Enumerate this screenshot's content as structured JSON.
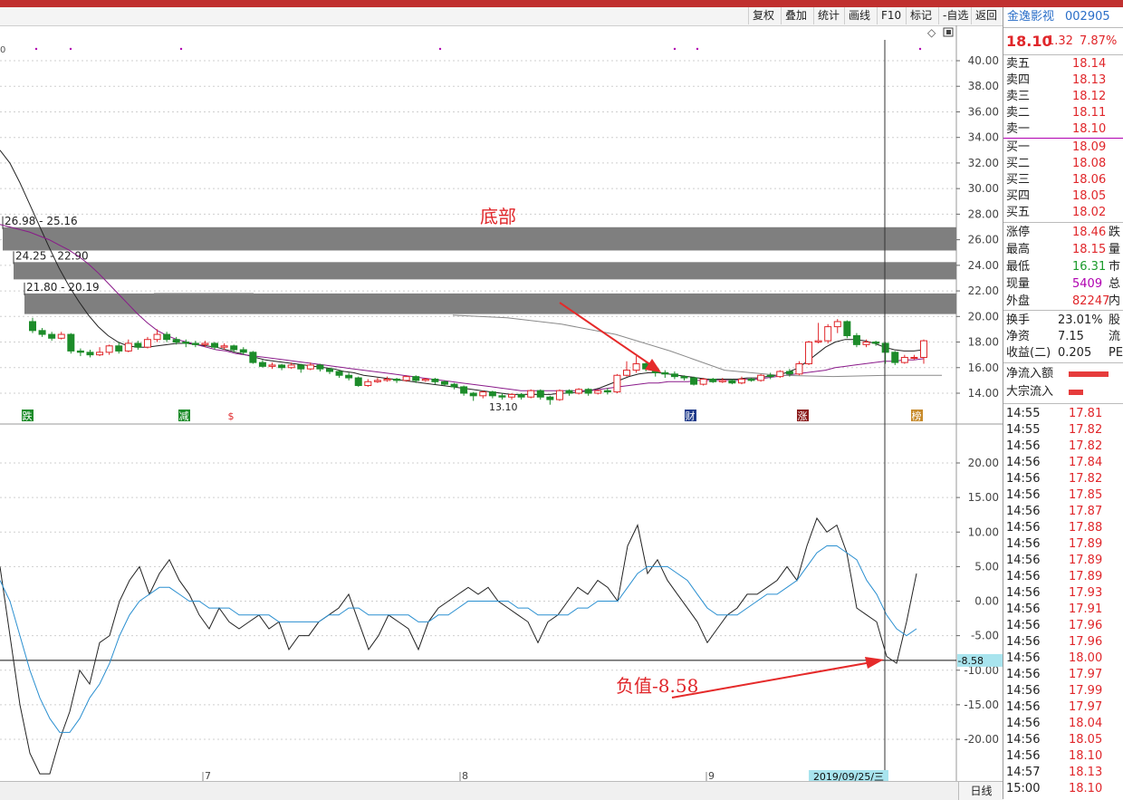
{
  "toolbar": {
    "buttons": [
      "复权",
      "叠加",
      "统计",
      "画线",
      "F10",
      "标记",
      "-自选",
      "返回"
    ]
  },
  "stock": {
    "name": "金逸影视",
    "code": "002905",
    "price": "18.10",
    "change": "1.32",
    "change_pct": "7.87%"
  },
  "order_book": {
    "asks": [
      {
        "label": "卖五",
        "price": "18.14"
      },
      {
        "label": "卖四",
        "price": "18.13"
      },
      {
        "label": "卖三",
        "price": "18.12"
      },
      {
        "label": "卖二",
        "price": "18.11"
      },
      {
        "label": "卖一",
        "price": "18.10"
      }
    ],
    "bids": [
      {
        "label": "买一",
        "price": "18.09"
      },
      {
        "label": "买二",
        "price": "18.08"
      },
      {
        "label": "买三",
        "price": "18.06"
      },
      {
        "label": "买四",
        "price": "18.05"
      },
      {
        "label": "买五",
        "price": "18.02"
      }
    ]
  },
  "stats": [
    {
      "label": "涨停",
      "value": "18.46",
      "tail": "跌"
    },
    {
      "label": "最高",
      "value": "18.15",
      "tail": "量"
    },
    {
      "label": "最低",
      "value": "16.31",
      "tail": "市"
    },
    {
      "label": "现量",
      "value": "5409",
      "tail": "总"
    },
    {
      "label": "外盘",
      "value": "82247",
      "tail": "内"
    }
  ],
  "stats2": [
    {
      "label": "换手",
      "value": "23.01%",
      "tail": "股"
    },
    {
      "label": "净资",
      "value": "7.15",
      "tail": "流"
    },
    {
      "label": "收益(二)",
      "value": "0.205",
      "tail": "PE"
    }
  ],
  "flows": [
    {
      "label": "净流入额"
    },
    {
      "label": "大宗流入"
    }
  ],
  "ticks": [
    {
      "t": "14:55",
      "p": "17.81"
    },
    {
      "t": "14:55",
      "p": "17.82"
    },
    {
      "t": "14:56",
      "p": "17.82"
    },
    {
      "t": "14:56",
      "p": "17.84"
    },
    {
      "t": "14:56",
      "p": "17.82"
    },
    {
      "t": "14:56",
      "p": "17.85"
    },
    {
      "t": "14:56",
      "p": "17.87"
    },
    {
      "t": "14:56",
      "p": "17.88"
    },
    {
      "t": "14:56",
      "p": "17.89"
    },
    {
      "t": "14:56",
      "p": "17.89"
    },
    {
      "t": "14:56",
      "p": "17.89"
    },
    {
      "t": "14:56",
      "p": "17.93"
    },
    {
      "t": "14:56",
      "p": "17.91"
    },
    {
      "t": "14:56",
      "p": "17.96"
    },
    {
      "t": "14:56",
      "p": "17.96"
    },
    {
      "t": "14:56",
      "p": "18.00"
    },
    {
      "t": "14:56",
      "p": "17.97"
    },
    {
      "t": "14:56",
      "p": "17.99"
    },
    {
      "t": "14:56",
      "p": "17.97"
    },
    {
      "t": "14:56",
      "p": "18.04"
    },
    {
      "t": "14:56",
      "p": "18.05"
    },
    {
      "t": "14:56",
      "p": "18.10"
    },
    {
      "t": "14:57",
      "p": "18.13"
    },
    {
      "t": "15:00",
      "p": "18.10"
    }
  ],
  "chart": {
    "price_axis": [
      "40.00",
      "38.00",
      "36.00",
      "34.00",
      "32.00",
      "30.00",
      "28.00",
      "26.00",
      "24.00",
      "22.00",
      "20.00",
      "18.00",
      "16.00",
      "14.00"
    ],
    "price_range": [
      14,
      40
    ],
    "osc_axis": [
      "20.00",
      "15.00",
      "10.00",
      "5.00",
      "0.00",
      "-5.00",
      "-10.00",
      "-15.00",
      "-20.00"
    ],
    "osc_range": [
      -20,
      20
    ],
    "osc_cursor": "-8.58",
    "zones": [
      {
        "label": "26.98 - 25.16",
        "high": 26.98,
        "low": 25.16
      },
      {
        "label": "24.25 - 22.90",
        "high": 24.25,
        "low": 22.9
      },
      {
        "label": "21.80 - 20.19",
        "high": 21.8,
        "low": 20.19
      }
    ],
    "low_marker": "13.10",
    "annotation_bottom": "底部",
    "annotation_neg": "负值-8.58",
    "date_cursor": "2019/09/25/三",
    "month_labels": [
      "7",
      "8",
      "9"
    ],
    "event_tags": [
      "跌",
      "减",
      "$",
      "财",
      "涨",
      "榜"
    ],
    "daily_label": "日线",
    "candles": [
      [
        19.6,
        18.9,
        19.9,
        18.7
      ],
      [
        18.9,
        18.6,
        19.1,
        18.4
      ],
      [
        18.6,
        18.3,
        18.8,
        18.1
      ],
      [
        18.3,
        18.6,
        18.8,
        18.2
      ],
      [
        18.6,
        17.3,
        18.7,
        17.1
      ],
      [
        17.3,
        17.2,
        17.5,
        16.9
      ],
      [
        17.2,
        17.0,
        17.4,
        16.8
      ],
      [
        17.0,
        17.2,
        17.6,
        16.9
      ],
      [
        17.2,
        17.7,
        17.8,
        17.0
      ],
      [
        17.7,
        17.3,
        18.0,
        17.1
      ],
      [
        17.3,
        17.9,
        18.2,
        17.2
      ],
      [
        17.9,
        17.6,
        18.1,
        17.4
      ],
      [
        17.6,
        18.2,
        18.4,
        17.5
      ],
      [
        18.2,
        18.6,
        19.0,
        18.0
      ],
      [
        18.6,
        18.2,
        18.8,
        18.0
      ],
      [
        18.2,
        18.0,
        18.4,
        17.8
      ],
      [
        18.0,
        17.9,
        18.2,
        17.6
      ],
      [
        17.9,
        17.8,
        18.1,
        17.6
      ],
      [
        17.8,
        17.9,
        18.1,
        17.6
      ],
      [
        17.9,
        17.6,
        18.0,
        17.4
      ],
      [
        17.6,
        17.7,
        17.9,
        17.4
      ],
      [
        17.7,
        17.4,
        17.8,
        17.2
      ],
      [
        17.4,
        17.2,
        17.6,
        17.0
      ],
      [
        17.2,
        16.4,
        17.3,
        16.3
      ],
      [
        16.4,
        16.1,
        16.6,
        16.0
      ],
      [
        16.1,
        16.2,
        16.4,
        15.9
      ],
      [
        16.2,
        16.0,
        16.3,
        15.8
      ],
      [
        16.0,
        16.2,
        16.4,
        15.9
      ],
      [
        16.2,
        15.9,
        16.3,
        15.6
      ],
      [
        15.9,
        16.2,
        16.4,
        15.8
      ],
      [
        16.2,
        15.9,
        16.3,
        15.7
      ],
      [
        15.9,
        15.7,
        16.0,
        15.5
      ],
      [
        15.7,
        15.4,
        15.8,
        15.2
      ],
      [
        15.4,
        15.2,
        15.6,
        15.0
      ],
      [
        15.2,
        14.6,
        15.3,
        14.5
      ],
      [
        14.6,
        14.9,
        15.1,
        14.5
      ],
      [
        14.9,
        15.0,
        15.2,
        14.8
      ],
      [
        15.0,
        15.1,
        15.3,
        14.9
      ],
      [
        15.1,
        15.0,
        15.2,
        14.8
      ],
      [
        15.0,
        15.3,
        15.4,
        14.9
      ],
      [
        15.3,
        15.0,
        15.4,
        14.8
      ],
      [
        15.0,
        15.1,
        15.2,
        14.9
      ],
      [
        15.1,
        14.9,
        15.2,
        14.7
      ],
      [
        14.9,
        14.7,
        15.0,
        14.6
      ],
      [
        14.7,
        14.5,
        14.8,
        14.3
      ],
      [
        14.5,
        14.0,
        14.6,
        13.8
      ],
      [
        14.0,
        13.8,
        14.1,
        13.4
      ],
      [
        13.8,
        14.1,
        14.2,
        13.6
      ],
      [
        14.1,
        13.8,
        14.2,
        13.6
      ],
      [
        13.8,
        13.7,
        14.0,
        13.5
      ],
      [
        13.7,
        13.9,
        14.0,
        13.5
      ],
      [
        13.9,
        13.7,
        14.0,
        13.5
      ],
      [
        13.7,
        14.2,
        14.3,
        13.6
      ],
      [
        14.2,
        13.7,
        14.3,
        13.5
      ],
      [
        13.7,
        13.5,
        13.8,
        13.1
      ],
      [
        13.5,
        14.2,
        14.3,
        13.4
      ],
      [
        14.2,
        14.0,
        14.3,
        13.8
      ],
      [
        14.0,
        14.3,
        14.4,
        13.9
      ],
      [
        14.3,
        14.0,
        14.4,
        13.8
      ],
      [
        14.0,
        14.2,
        14.3,
        13.9
      ],
      [
        14.2,
        14.1,
        14.4,
        13.9
      ],
      [
        14.1,
        15.4,
        15.5,
        14.0
      ],
      [
        15.4,
        15.8,
        16.5,
        15.3
      ],
      [
        15.8,
        16.3,
        16.9,
        15.6
      ],
      [
        16.3,
        15.9,
        16.5,
        15.7
      ],
      [
        15.9,
        15.6,
        16.0,
        15.3
      ],
      [
        15.6,
        15.5,
        15.8,
        15.2
      ],
      [
        15.5,
        15.3,
        15.7,
        15.1
      ],
      [
        15.3,
        15.2,
        15.4,
        15.0
      ],
      [
        15.2,
        14.7,
        15.3,
        14.6
      ],
      [
        14.7,
        15.1,
        15.2,
        14.6
      ],
      [
        15.1,
        14.9,
        15.2,
        14.8
      ],
      [
        14.9,
        15.0,
        15.2,
        14.8
      ],
      [
        15.0,
        14.8,
        15.1,
        14.7
      ],
      [
        14.8,
        15.1,
        15.3,
        14.7
      ],
      [
        15.1,
        15.0,
        15.2,
        14.9
      ],
      [
        15.0,
        15.4,
        15.5,
        14.9
      ],
      [
        15.4,
        15.3,
        15.6,
        15.1
      ],
      [
        15.3,
        15.7,
        15.8,
        15.2
      ],
      [
        15.7,
        15.5,
        15.9,
        15.3
      ],
      [
        15.5,
        16.3,
        16.5,
        15.4
      ],
      [
        16.3,
        18.0,
        18.1,
        16.2
      ],
      [
        18.0,
        18.1,
        19.5,
        17.9
      ],
      [
        18.1,
        19.2,
        19.4,
        17.9
      ],
      [
        19.2,
        19.6,
        19.8,
        18.7
      ],
      [
        19.6,
        18.5,
        19.7,
        18.3
      ],
      [
        18.5,
        17.8,
        18.7,
        17.6
      ],
      [
        17.8,
        18.0,
        18.2,
        17.6
      ],
      [
        18.0,
        17.9,
        18.1,
        17.7
      ],
      [
        17.9,
        17.2,
        18.0,
        16.3
      ],
      [
        17.2,
        16.4,
        17.3,
        16.2
      ],
      [
        16.4,
        16.8,
        17.0,
        16.3
      ],
      [
        16.8,
        16.8,
        17.0,
        16.6
      ],
      [
        16.8,
        18.1,
        18.2,
        16.3
      ]
    ],
    "ma_fast": [
      33,
      32,
      30.5,
      28.8,
      27.1,
      25.4,
      23.8,
      22.4,
      21.2,
      20.1,
      19.2,
      18.5,
      18,
      17.7,
      17.6,
      17.6,
      17.7,
      17.8,
      17.9,
      17.9,
      17.8,
      17.7,
      17.6,
      17.4,
      17.2,
      17,
      16.8,
      16.6,
      16.5,
      16.4,
      16.3,
      16.2,
      16.1,
      16,
      15.9,
      15.7,
      15.6,
      15.4,
      15.3,
      15.2,
      15.1,
      15,
      14.9,
      14.8,
      14.7,
      14.6,
      14.5,
      14.4,
      14.3,
      14.2,
      14.1,
      14,
      13.9,
      13.9,
      13.9,
      13.9,
      13.9,
      14,
      14,
      14.1,
      14.2,
      14.4,
      14.7,
      15,
      15.3,
      15.5,
      15.6,
      15.6,
      15.5,
      15.4,
      15.3,
      15.2,
      15.1,
      15.1,
      15.1,
      15.1,
      15.2,
      15.2,
      15.3,
      15.4,
      15.6,
      15.9,
      16.4,
      17,
      17.6,
      18,
      18.2,
      18.2,
      18.1,
      17.9,
      17.6,
      17.4,
      17.3,
      17.3,
      17.4
    ],
    "ma_slow": [
      27.2,
      27.0,
      26.8,
      26.6,
      26.3,
      26.0,
      25.6,
      25.2,
      24.7,
      24.1,
      23.4,
      22.6,
      21.8,
      21.0,
      20.2,
      19.5,
      18.9,
      18.5,
      18.2,
      18.0,
      17.8,
      17.6,
      17.4,
      17.3,
      17.1,
      17.0,
      16.9,
      16.8,
      16.7,
      16.6,
      16.5,
      16.4,
      16.3,
      16.2,
      16.1,
      16.0,
      15.9,
      15.8,
      15.7,
      15.6,
      15.5,
      15.4,
      15.3,
      15.2,
      15.1,
      15.0,
      14.9,
      14.8,
      14.7,
      14.6,
      14.5,
      14.4,
      14.3,
      14.2,
      14.2,
      14.2,
      14.2,
      14.2,
      14.2,
      14.2,
      14.2,
      14.3,
      14.4,
      14.5,
      14.6,
      14.7,
      14.8,
      14.8,
      14.9,
      14.9,
      14.9,
      15.0,
      15.0,
      15.0,
      15.0,
      15.0,
      15.1,
      15.1,
      15.2,
      15.3,
      15.4,
      15.5,
      15.6,
      15.7,
      15.8,
      16.0,
      16.1,
      16.2,
      16.3,
      16.4,
      16.5,
      16.5,
      16.6,
      16.6,
      16.7
    ],
    "ma_long": [
      [
        500,
        20.1
      ],
      [
        560,
        19.9
      ],
      [
        620,
        19.4
      ],
      [
        680,
        18.6
      ],
      [
        740,
        17.3
      ],
      [
        800,
        15.8
      ],
      [
        860,
        15.4
      ],
      [
        920,
        15.3
      ],
      [
        980,
        15.4
      ],
      [
        1040,
        15.4
      ]
    ],
    "ma_long_early": [
      [
        170,
        21.8
      ],
      [
        280,
        21.8
      ]
    ],
    "osc_line": [
      5,
      -5,
      -15,
      -22,
      -25,
      -25,
      -20,
      -16,
      -10,
      -12,
      -6,
      -5,
      0,
      3,
      5,
      1,
      4,
      6,
      3,
      1,
      -2,
      -4,
      -1,
      -3,
      -4,
      -3,
      -2,
      -4,
      -3,
      -7,
      -5,
      -5,
      -3,
      -2,
      -1,
      1,
      -3,
      -7,
      -5,
      -2,
      -3,
      -4,
      -7,
      -3,
      -1,
      0,
      1,
      2,
      1,
      2,
      0,
      -1,
      -2,
      -3,
      -6,
      -3,
      -2,
      0,
      2,
      1,
      3,
      2,
      0,
      8,
      11,
      4,
      6,
      3,
      1,
      -1,
      -3,
      -6,
      -4,
      -2,
      -1,
      1,
      1,
      2,
      3,
      5,
      3,
      8,
      12,
      10,
      11,
      7,
      -1,
      -2,
      -3,
      -8,
      -9,
      -3,
      4
    ],
    "osc_signal": [
      3,
      0,
      -5,
      -10,
      -14,
      -17,
      -19,
      -19,
      -17,
      -14,
      -12,
      -9,
      -5,
      -2,
      0,
      1,
      2,
      2,
      1,
      0,
      0,
      -1,
      -1,
      -1,
      -2,
      -2,
      -2,
      -2,
      -3,
      -3,
      -3,
      -3,
      -3,
      -2,
      -2,
      -1,
      -1,
      -2,
      -2,
      -2,
      -2,
      -2,
      -3,
      -3,
      -2,
      -2,
      -1,
      0,
      0,
      0,
      0,
      0,
      -1,
      -1,
      -2,
      -2,
      -2,
      -2,
      -1,
      -1,
      0,
      0,
      0,
      2,
      4,
      5,
      5,
      5,
      4,
      3,
      1,
      -1,
      -2,
      -2,
      -2,
      -1,
      0,
      1,
      1,
      2,
      3,
      5,
      7,
      8,
      8,
      7,
      6,
      3,
      1,
      -2,
      -4,
      -5,
      -4
    ],
    "colors": {
      "up": "#e0262a",
      "down": "#1d8c2a",
      "ma_fast": "#222222",
      "ma_slow": "#8a1a8a",
      "ma_long": "#8a8a8a",
      "osc_main": "#222222",
      "osc_signal": "#2a8fd0",
      "zone": "#7f7f7f",
      "arrow": "#e52a2a"
    }
  }
}
